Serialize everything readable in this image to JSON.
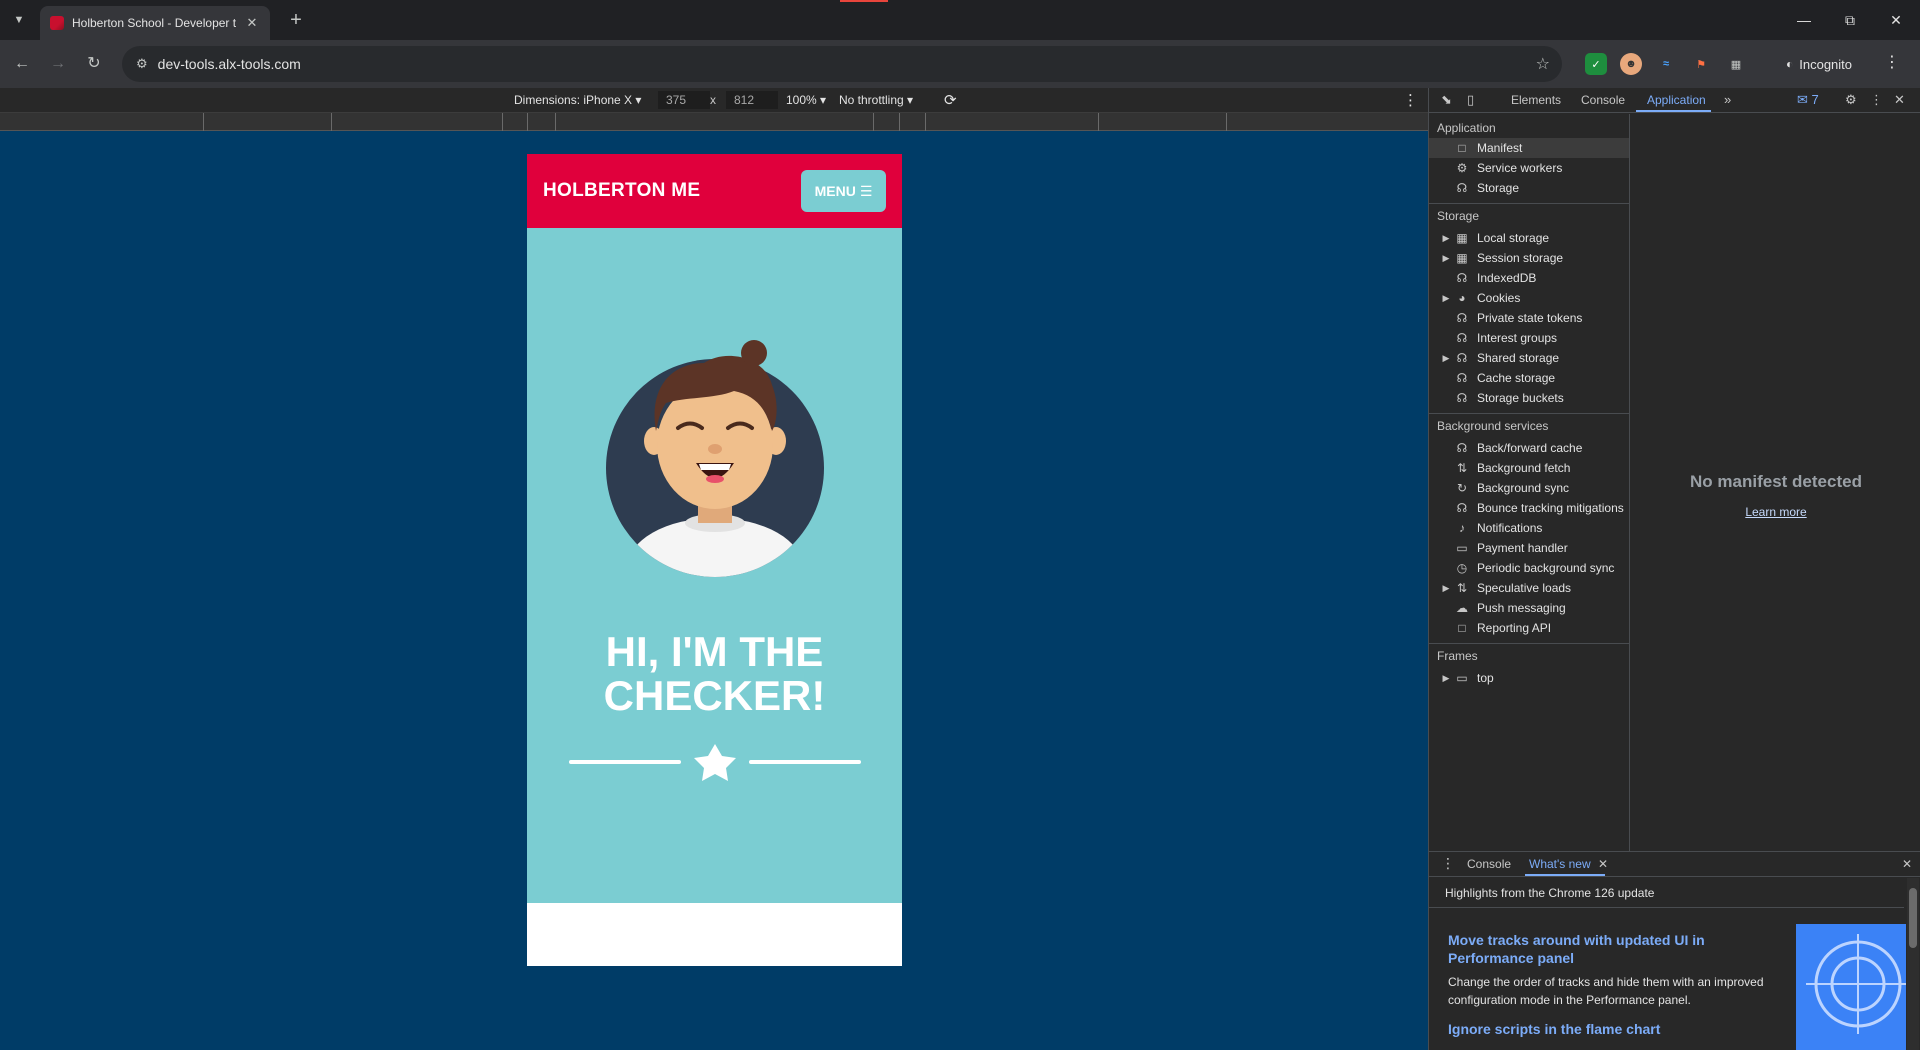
{
  "browser": {
    "tab_title": "Holberton School - Developer t",
    "url": "dev-tools.alx-tools.com",
    "incognito_label": "Incognito"
  },
  "device_toolbar": {
    "dimensions_label": "Dimensions: iPhone X",
    "width_value": "375",
    "times": "x",
    "height_value": "812",
    "zoom": "100%",
    "throttling": "No throttling"
  },
  "site": {
    "brand": "HOLBERTON ME",
    "menu_label": "MENU",
    "hero_line1": "HI, I'M THE",
    "hero_line2": "CHECKER!"
  },
  "devtools": {
    "tabs": [
      "Elements",
      "Console",
      "Application"
    ],
    "issues_count": "7",
    "sections": {
      "application": {
        "title": "Application",
        "items": [
          "Manifest",
          "Service workers",
          "Storage"
        ]
      },
      "storage": {
        "title": "Storage",
        "items": [
          "Local storage",
          "Session storage",
          "IndexedDB",
          "Cookies",
          "Private state tokens",
          "Interest groups",
          "Shared storage",
          "Cache storage",
          "Storage buckets"
        ]
      },
      "background": {
        "title": "Background services",
        "items": [
          "Back/forward cache",
          "Background fetch",
          "Background sync",
          "Bounce tracking mitigations",
          "Notifications",
          "Payment handler",
          "Periodic background sync",
          "Speculative loads",
          "Push messaging",
          "Reporting API"
        ]
      },
      "frames": {
        "title": "Frames",
        "items": [
          "top"
        ]
      }
    },
    "manifest": {
      "empty_title": "No manifest detected",
      "learn_more": "Learn more"
    },
    "drawer": {
      "tabs": [
        "Console",
        "What's new"
      ],
      "highlights": "Highlights from the Chrome 126 update",
      "articles": [
        {
          "title": "Move tracks around with updated UI in Performance panel",
          "desc": "Change the order of tracks and hide them with an improved configuration mode in the Performance panel."
        },
        {
          "title": "Ignore scripts in the flame chart",
          "desc": ""
        }
      ]
    }
  },
  "colors": {
    "viewport_bg": "#003c67",
    "header_red": "#e0003c",
    "hero_teal": "#7bcdd2",
    "devtools_accent": "#7cacf8"
  }
}
